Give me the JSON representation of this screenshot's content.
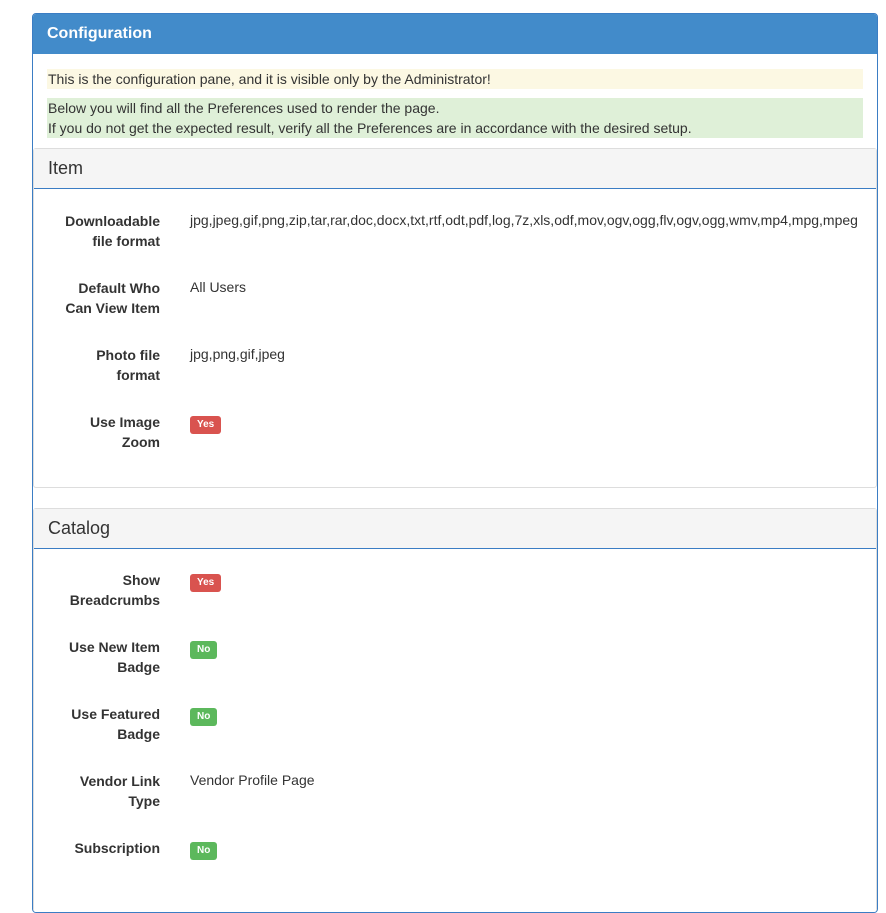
{
  "panel": {
    "title": "Configuration",
    "warning": "This is the configuration pane, and it is visible only by the Administrator!",
    "info_line1": "Below you will find all the Preferences used to render the page.",
    "info_line2": "If you do not get the expected result, verify all the Preferences are in accordance with the desired setup."
  },
  "item_section": {
    "title": "Item",
    "rows": [
      {
        "label_line1": "Downloadable",
        "label_line2": "file format",
        "value": "jpg,jpeg,gif,png,zip,tar,rar,doc,docx,txt,rtf,odt,pdf,log,7z,xls,odf,mov,ogv,ogg,flv,ogv,ogg,wmv,mp4,mpg,mpeg"
      },
      {
        "label_line1": "Default Who",
        "label_line2": "Can View Item",
        "value": "All Users"
      },
      {
        "label_line1": "Photo file",
        "label_line2": "format",
        "value": "jpg,png,gif,jpeg"
      },
      {
        "label_line1": "Use Image",
        "label_line2": "Zoom",
        "badge": "Yes"
      }
    ]
  },
  "catalog_section": {
    "title": "Catalog",
    "rows": [
      {
        "label_line1": "Show",
        "label_line2": "Breadcrumbs",
        "badge": "Yes"
      },
      {
        "label_line1": "Use New Item",
        "label_line2": "Badge",
        "badge": "No"
      },
      {
        "label_line1": "Use Featured",
        "label_line2": "Badge",
        "badge": "No"
      },
      {
        "label_line1": "Vendor Link",
        "label_line2": "Type",
        "value": "Vendor Profile Page"
      },
      {
        "label_line1": "Subscription",
        "label_line2": "",
        "badge": "No"
      }
    ]
  },
  "colors": {
    "header": "#428bca",
    "badge_yes": "#d9534f",
    "badge_no": "#5cb85c"
  }
}
